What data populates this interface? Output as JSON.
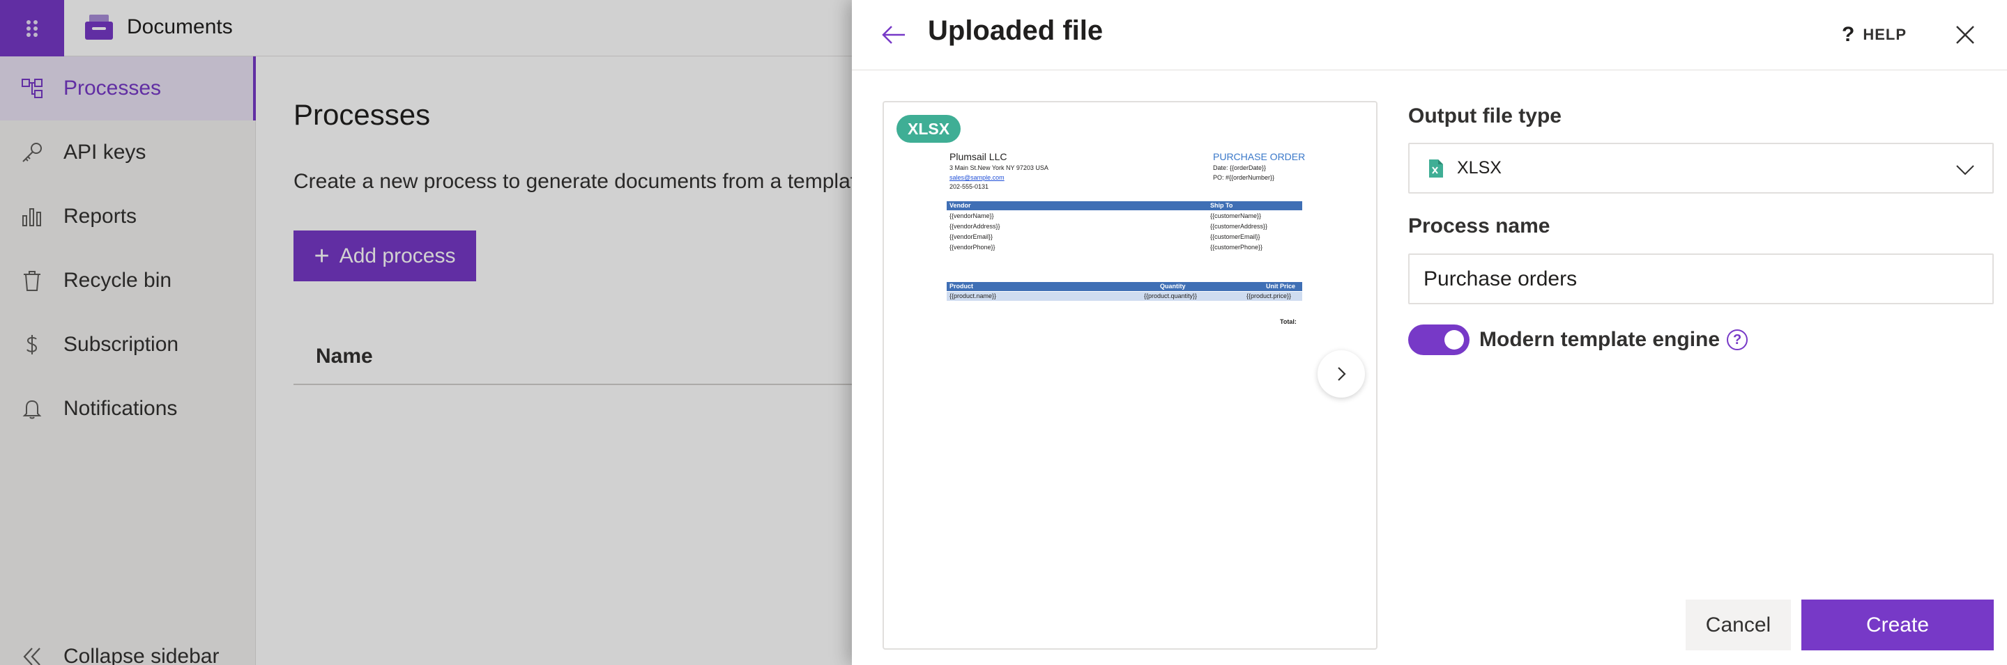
{
  "app": {
    "brand_name": "Documents",
    "launcher_icon": "app-launcher-icon",
    "brand_icon": "documents-tray-icon",
    "accent_color": "#7739c7"
  },
  "sidebar": {
    "items": [
      {
        "label": "Processes",
        "icon": "processes-icon",
        "active": true
      },
      {
        "label": "API keys",
        "icon": "key-icon",
        "active": false
      },
      {
        "label": "Reports",
        "icon": "bar-chart-icon",
        "active": false
      },
      {
        "label": "Recycle bin",
        "icon": "trash-icon",
        "active": false
      },
      {
        "label": "Subscription",
        "icon": "dollar-icon",
        "active": false
      },
      {
        "label": "Notifications",
        "icon": "bell-icon",
        "active": false
      }
    ],
    "collapse_label": "Collapse sidebar"
  },
  "main": {
    "title": "Processes",
    "description": "Create a new process to generate documents from a templat",
    "add_button_label": "Add process",
    "table_column_name": "Name"
  },
  "panel": {
    "title": "Uploaded file",
    "help_label": "HELP",
    "help_glyph": "?",
    "preview": {
      "badge": "XLSX",
      "doc": {
        "company": "Plumsail LLC",
        "address": "3 Main St.New York NY 97203 USA",
        "email": "sales@sample.com",
        "phone": "202-555-0131",
        "po_title": "PURCHASE ORDER",
        "po_date": "Date: {{orderDate}}",
        "po_number": "PO: #{{orderNumber}}",
        "vendor_header": "Vendor",
        "shipto_header": "Ship To",
        "vendor_fields": [
          "{{vendorName}}",
          "{{vendorAddress}}",
          "{{vendorEmail}}",
          "{{vendorPhone}}"
        ],
        "customer_fields": [
          "{{customerName}}",
          "{{customerAddress}}",
          "{{customerEmail}}",
          "{{customerPhone}}"
        ],
        "product_header": "Product",
        "quantity_header": "Quantity",
        "unit_price_header": "Unit Price",
        "product_cell": "{{product.name}}",
        "quantity_cell": "{{product.quantity}}",
        "price_cell": "{{product.price}}",
        "total_label": "Total:"
      }
    },
    "form": {
      "output_type_label": "Output file type",
      "output_type_value": "XLSX",
      "process_name_label": "Process name",
      "process_name_value": "Purchase orders",
      "toggle_label": "Modern template engine",
      "toggle_on": true,
      "toggle_help_glyph": "?"
    },
    "buttons": {
      "cancel": "Cancel",
      "create": "Create"
    }
  }
}
